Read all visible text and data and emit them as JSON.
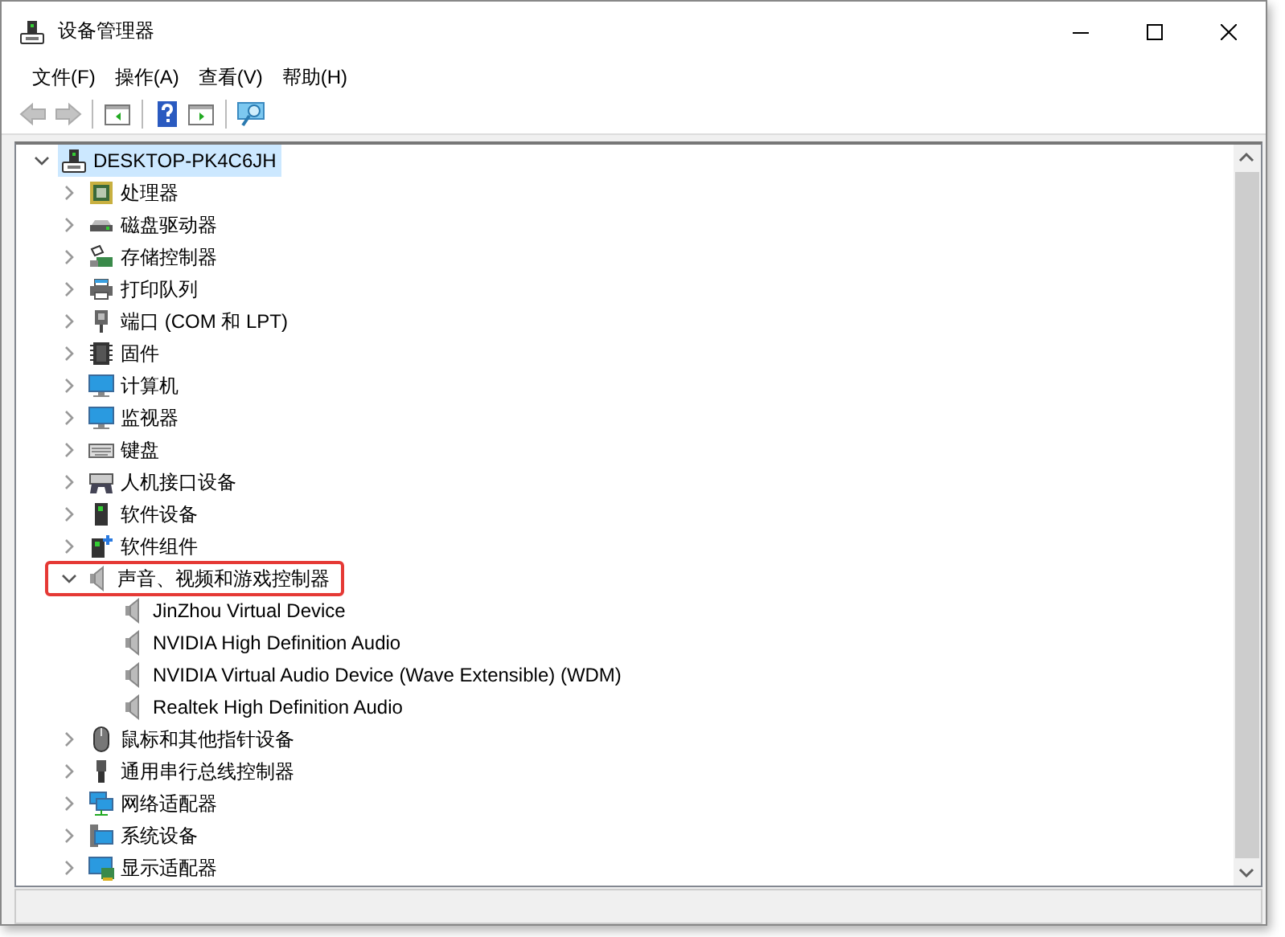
{
  "window": {
    "title": "设备管理器"
  },
  "menu": [
    "文件(F)",
    "操作(A)",
    "查看(V)",
    "帮助(H)"
  ],
  "toolbar": [
    {
      "kind": "back",
      "disabled": true
    },
    {
      "kind": "forward",
      "disabled": true
    },
    {
      "kind": "sep"
    },
    {
      "kind": "console"
    },
    {
      "kind": "sep"
    },
    {
      "kind": "help"
    },
    {
      "kind": "action"
    },
    {
      "kind": "sep"
    },
    {
      "kind": "scan"
    }
  ],
  "tree": [
    {
      "label": "DESKTOP-PK4C6JH",
      "kind": "computer-root",
      "expanded": true,
      "selected": true,
      "highlighted": false,
      "children": [
        {
          "label": "处理器",
          "kind": "cpu",
          "expanded": false,
          "selected": false,
          "highlighted": false
        },
        {
          "label": "磁盘驱动器",
          "kind": "disk",
          "expanded": false,
          "selected": false,
          "highlighted": false
        },
        {
          "label": "存储控制器",
          "kind": "storage",
          "expanded": false,
          "selected": false,
          "highlighted": false
        },
        {
          "label": "打印队列",
          "kind": "printer",
          "expanded": false,
          "selected": false,
          "highlighted": false
        },
        {
          "label": "端口 (COM 和 LPT)",
          "kind": "port",
          "expanded": false,
          "selected": false,
          "highlighted": false
        },
        {
          "label": "固件",
          "kind": "chip",
          "expanded": false,
          "selected": false,
          "highlighted": false
        },
        {
          "label": "计算机",
          "kind": "monitor",
          "expanded": false,
          "selected": false,
          "highlighted": false
        },
        {
          "label": "监视器",
          "kind": "monitor",
          "expanded": false,
          "selected": false,
          "highlighted": false
        },
        {
          "label": "键盘",
          "kind": "keyboard",
          "expanded": false,
          "selected": false,
          "highlighted": false
        },
        {
          "label": "人机接口设备",
          "kind": "hid",
          "expanded": false,
          "selected": false,
          "highlighted": false
        },
        {
          "label": "软件设备",
          "kind": "software",
          "expanded": false,
          "selected": false,
          "highlighted": false
        },
        {
          "label": "软件组件",
          "kind": "component",
          "expanded": false,
          "selected": false,
          "highlighted": false
        },
        {
          "label": "声音、视频和游戏控制器",
          "kind": "speaker",
          "expanded": true,
          "selected": false,
          "highlighted": true,
          "children": [
            {
              "label": "JinZhou Virtual Device",
              "kind": "speaker",
              "selected": false,
              "highlighted": false
            },
            {
              "label": "NVIDIA High Definition Audio",
              "kind": "speaker",
              "selected": false,
              "highlighted": false
            },
            {
              "label": "NVIDIA Virtual Audio Device (Wave Extensible) (WDM)",
              "kind": "speaker",
              "selected": false,
              "highlighted": false
            },
            {
              "label": "Realtek High Definition Audio",
              "kind": "speaker",
              "selected": false,
              "highlighted": false
            }
          ]
        },
        {
          "label": "鼠标和其他指针设备",
          "kind": "mouse",
          "expanded": false,
          "selected": false,
          "highlighted": false
        },
        {
          "label": "通用串行总线控制器",
          "kind": "usb",
          "expanded": false,
          "selected": false,
          "highlighted": false
        },
        {
          "label": "网络适配器",
          "kind": "network",
          "expanded": false,
          "selected": false,
          "highlighted": false
        },
        {
          "label": "系统设备",
          "kind": "system",
          "expanded": false,
          "selected": false,
          "highlighted": false
        },
        {
          "label": "显示适配器",
          "kind": "display",
          "expanded": false,
          "selected": false,
          "highlighted": false
        }
      ]
    }
  ]
}
